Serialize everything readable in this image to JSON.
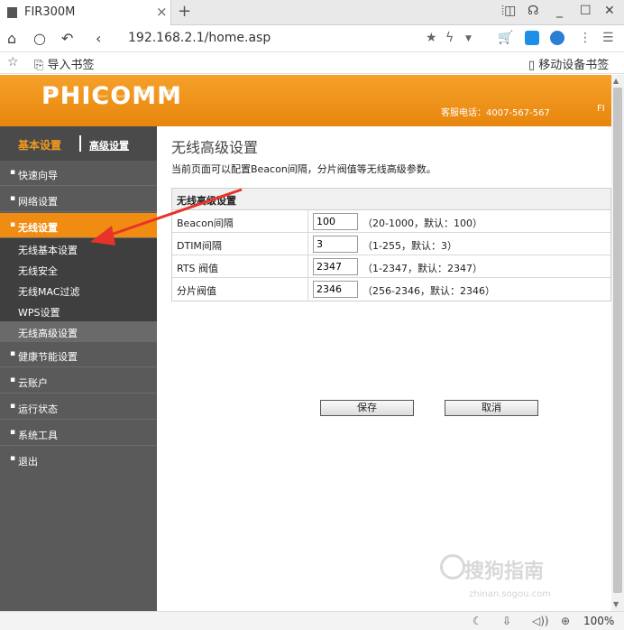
{
  "browser": {
    "tab_title": "FIR300M",
    "tab_close": "×",
    "new_tab": "+",
    "url": "192.168.2.1/home.asp",
    "bookmark_import": "导入书签",
    "bookmark_mobile": "移动设备书签",
    "zoom": "100%"
  },
  "header": {
    "logo": "PHICOMM",
    "hotline": "客服电话：4007-567-567",
    "right_text": "FI"
  },
  "sidebar": {
    "basic_settings": "基本设置",
    "advanced_settings": "高级设置",
    "menu": [
      {
        "label": "快速向导"
      },
      {
        "label": "网络设置"
      },
      {
        "label": "无线设置"
      },
      {
        "label": "健康节能设置"
      },
      {
        "label": "云账户"
      },
      {
        "label": "运行状态"
      },
      {
        "label": "系统工具"
      },
      {
        "label": "退出"
      }
    ],
    "wireless_submenu": [
      {
        "label": "无线基本设置"
      },
      {
        "label": "无线安全"
      },
      {
        "label": "无线MAC过滤"
      },
      {
        "label": "WPS设置"
      },
      {
        "label": "无线高级设置"
      }
    ]
  },
  "content": {
    "title": "无线高级设置",
    "description": "当前页面可以配置Beacon间隔，分片阀值等无线高级参数。",
    "panel_title": "无线高级设置",
    "rows": [
      {
        "label": "Beacon间隔",
        "value": "100",
        "hint": "（20-1000，默认：100）"
      },
      {
        "label": "DTIM间隔",
        "value": "3",
        "hint": "（1-255，默认：3）"
      },
      {
        "label": "RTS 阀值",
        "value": "2347",
        "hint": "（1-2347，默认：2347）"
      },
      {
        "label": "分片阀值",
        "value": "2346",
        "hint": "（256-2346，默认：2346）"
      }
    ],
    "save_label": "保存",
    "cancel_label": "取消"
  },
  "watermark": {
    "text": "搜狗指南",
    "sub": "zhinan.sogou.com"
  },
  "colors": {
    "accent": "#f08c12",
    "sidebar": "#5a5a5a",
    "arrow": "#e8332a"
  }
}
